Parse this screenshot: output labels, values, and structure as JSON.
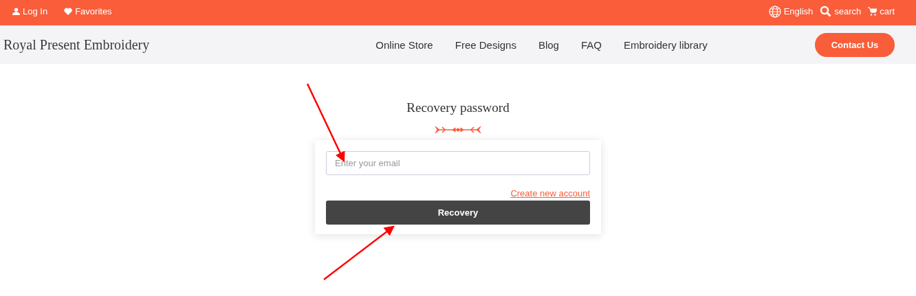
{
  "top_bar": {
    "left": [
      {
        "kind": "user",
        "label": "Log In"
      },
      {
        "kind": "heart",
        "label": "Favorites"
      }
    ],
    "right": [
      {
        "kind": "globe",
        "label": "English"
      },
      {
        "kind": "search",
        "label": "search"
      },
      {
        "kind": "cart",
        "label": "cart"
      }
    ]
  },
  "header": {
    "brand": "Royal Present Embroidery",
    "nav": [
      "Online Store",
      "Free Designs",
      "Blog",
      "FAQ",
      "Embroidery library"
    ],
    "cta": "Contact Us"
  },
  "form": {
    "title": "Recovery password",
    "email": {
      "placeholder": "Enter your email"
    },
    "link": "Create new account",
    "submit": "Recovery"
  }
}
